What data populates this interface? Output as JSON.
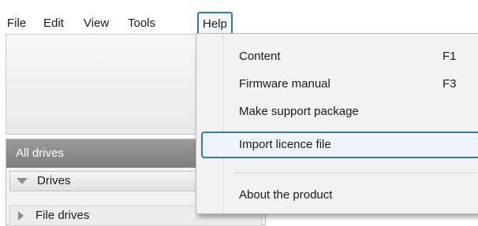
{
  "menubar": {
    "items": [
      {
        "label": "File"
      },
      {
        "label": "Edit"
      },
      {
        "label": "View"
      },
      {
        "label": "Tools"
      },
      {
        "label": "Help"
      }
    ]
  },
  "panel": {
    "header": "All drives",
    "drives_label": "Drives",
    "file_drives_label": "File drives"
  },
  "help_menu": {
    "items": [
      {
        "label": "Content",
        "shortcut": "F1"
      },
      {
        "label": "Firmware manual",
        "shortcut": "F3"
      },
      {
        "label": "Make support package",
        "shortcut": ""
      },
      {
        "label": "Import licence file",
        "shortcut": ""
      },
      {
        "label": "About the product",
        "shortcut": ""
      }
    ],
    "highlighted_item": "Import licence file"
  },
  "colors": {
    "accent": "#2b7bc0",
    "panel_header": "#8a8a8a",
    "menu_background": "#f2f2f2"
  }
}
